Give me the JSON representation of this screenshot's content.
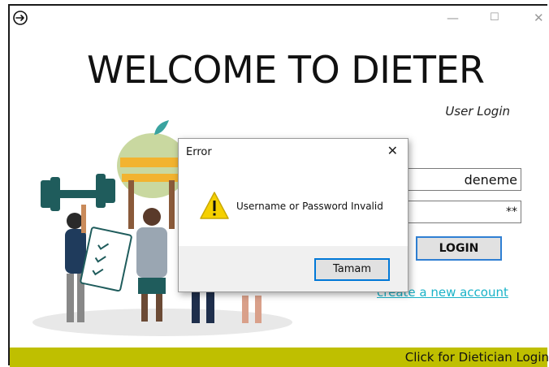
{
  "window": {
    "minimize_glyph": "—",
    "maximize_glyph": "☐",
    "close_glyph": "✕"
  },
  "header": {
    "title": "WELCOME TO DIETER",
    "subtitle": "User Login"
  },
  "form": {
    "username_value": "deneme",
    "password_value": "**",
    "login_label": "LOGIN",
    "create_account_link": "create a new account"
  },
  "footer": {
    "label": "Click for Dietician Login",
    "color": "#bfbf00"
  },
  "dialog": {
    "title": "Error",
    "close_glyph": "✕",
    "icon": "warning-icon",
    "message": "Username or Password Invalid",
    "ok_label": "Tamam"
  },
  "colors": {
    "accent": "#2f7fd3",
    "link": "#1ab3c8",
    "warning": "#f5d000"
  }
}
